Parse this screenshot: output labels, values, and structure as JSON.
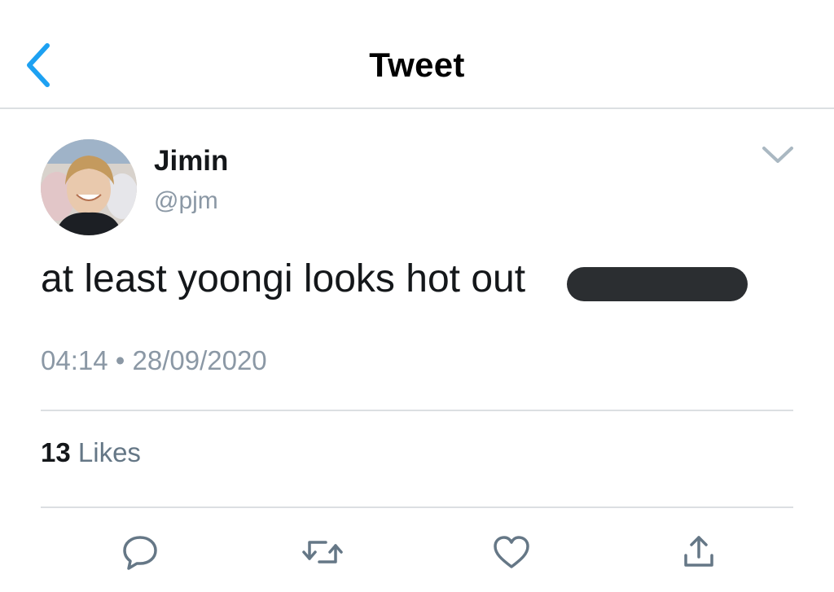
{
  "header": {
    "title": "Tweet",
    "back_icon": "chevron-left-icon"
  },
  "tweet": {
    "author": {
      "name": "Jimin",
      "handle": "@pjm"
    },
    "text": "at least yoongi looks hot out",
    "redacted": true,
    "time": "04:14",
    "date": "28/09/2020",
    "likes": {
      "count": "13",
      "label": "Likes"
    }
  },
  "actions": [
    {
      "name": "reply",
      "icon": "reply-icon"
    },
    {
      "name": "retweet",
      "icon": "retweet-icon"
    },
    {
      "name": "like",
      "icon": "heart-icon"
    },
    {
      "name": "share",
      "icon": "share-icon"
    }
  ],
  "colors": {
    "accent": "#1da1f2",
    "text": "#14171a",
    "secondary": "#8b98a5",
    "divider": "#dcdfe2",
    "icon": "#657786"
  }
}
